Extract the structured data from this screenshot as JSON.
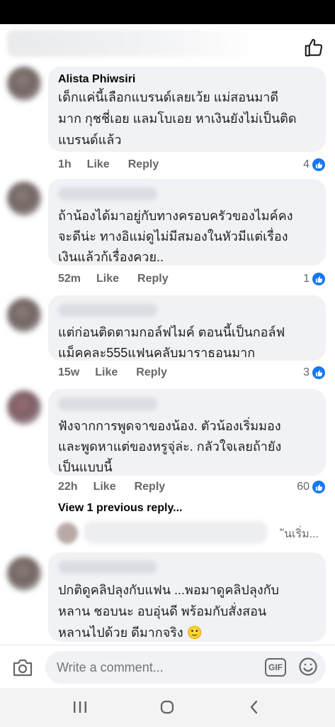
{
  "comments": [
    {
      "author": "Alista Phiwsiri",
      "text": "เด็กแค่นี้เลือกแบรนด์เลยเว้ย แม่สอนมาดี\nมาก กุชชี่เอย แลมโบเอย หาเงินยังไม่เป็นติด\nแบรนด์แล้ว",
      "time": "1h",
      "like_label": "Like",
      "reply_label": "Reply",
      "reaction_count": "4"
    },
    {
      "author": "",
      "text": "ถ้าน้องได้มาอยู่กับทางครอบครัวของไมค์คง\nจะดีน่ะ ทางอิแม่ดูไม่มีสมองในหัวมีแต่เรื่อง\nเงินแล้วก้เรื่องควย..",
      "time": "52m",
      "like_label": "Like",
      "reply_label": "Reply",
      "reaction_count": "1"
    },
    {
      "author": "",
      "text": "แต่ก่อนติดตามกอล์ฟไมค์ ตอนนี้เป็นกอล์ฟ\nแม็คคละ555แฟนคลับมาราธอนมาก",
      "time": "15w",
      "like_label": "Like",
      "reply_label": "Reply",
      "reaction_count": "3"
    },
    {
      "author": "",
      "text": "ฟังจากการพูดจาของน้อง. ตัวน้องเริ่มมอง\nและพูดหาแต่ของหรูจุ่ล่ะ. กลัวใจเลยถ้ายัง\nเป็นแบบนี้",
      "time": "22h",
      "like_label": "Like",
      "reply_label": "Reply",
      "reaction_count": "60"
    },
    {
      "author": "",
      "text": "ปกติดูคลิปลุงกับแฟน ...พอมาดูคลิปลุงกับ\nหลาน ชอบนะ อบอุ่นดี พร้อมกับสั่งสอน\nหลานไปด้วย ดีมากจริง 🙂",
      "time": "",
      "like_label": "",
      "reply_label": "",
      "reaction_count": ""
    }
  ],
  "view_replies_label": "View 1 previous reply...",
  "reply_preview_text": "ันเริ่ม...",
  "composer": {
    "placeholder": "Write a comment...",
    "gif_label": "GIF"
  },
  "icons": {
    "top_like": "thumbs-up-outline-icon",
    "reaction": "like-reaction-icon",
    "camera": "camera-icon",
    "emoji": "smiley-icon",
    "nav_recents": "recents-icon",
    "nav_home": "home-icon",
    "nav_back": "back-icon"
  },
  "colors": {
    "accent": "#1877f2",
    "bubble": "#f0f2f5",
    "meta": "#65676b"
  }
}
